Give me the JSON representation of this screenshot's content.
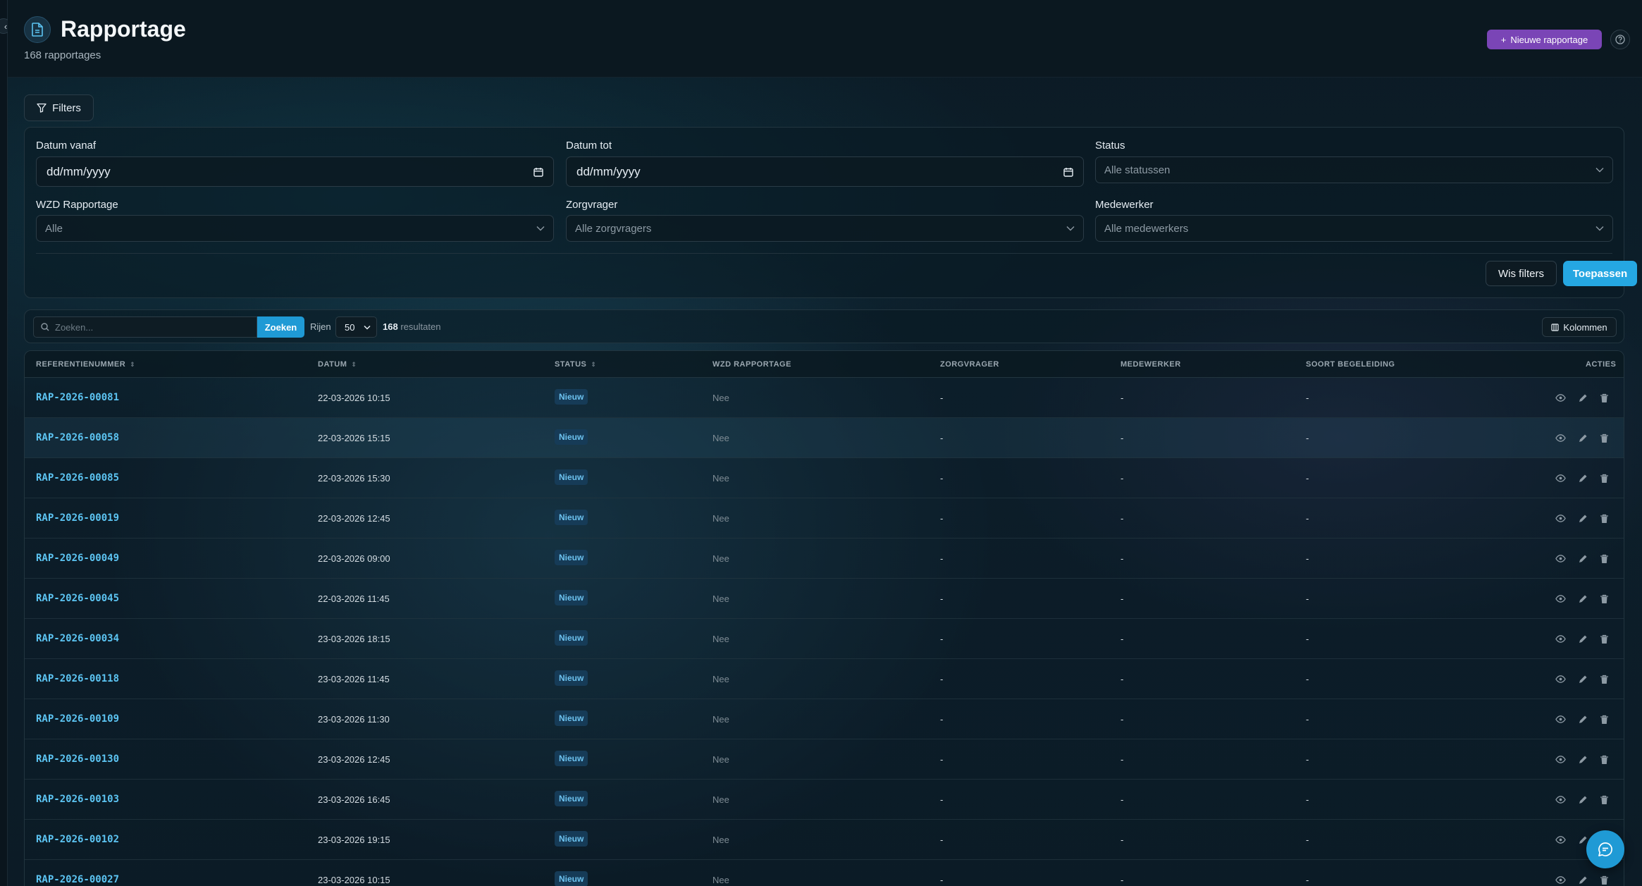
{
  "header": {
    "title": "Rapportage",
    "subtitle": "168 rapportages",
    "new_button": "Nieuwe rapportage",
    "new_icon": "+"
  },
  "filters": {
    "toggle_label": "Filters",
    "date_from_label": "Datum vanaf",
    "date_from_placeholder": "dd/mm/yyyy",
    "date_to_label": "Datum tot",
    "date_to_placeholder": "dd/mm/yyyy",
    "status_label": "Status",
    "status_value": "Alle statussen",
    "wzd_label": "WZD Rapportage",
    "wzd_value": "Alle",
    "client_label": "Zorgvrager",
    "client_value": "Alle zorgvragers",
    "employee_label": "Medewerker",
    "employee_value": "Alle medewerkers",
    "clear_button": "Wis filters",
    "apply_button": "Toepassen"
  },
  "toolbar": {
    "search_placeholder": "Zoeken...",
    "search_button": "Zoeken",
    "rows_label": "Rijen",
    "rows_value": "50",
    "results_count": "168",
    "results_label": "resultaten",
    "columns_button": "Kolommen"
  },
  "table": {
    "headers": {
      "ref": "REFERENTIENUMMER",
      "date": "DATUM",
      "status": "STATUS",
      "wzd": "WZD RAPPORTAGE",
      "client": "ZORGVRAGER",
      "employee": "MEDEWERKER",
      "type": "SOORT BEGELEIDING",
      "actions": "ACTIES"
    },
    "rows": [
      {
        "ref": "RAP-2026-00081",
        "date": "22-03-2026 10:15",
        "status": "Nieuw",
        "wzd": "Nee",
        "client": "-",
        "employee": "-",
        "type": "-"
      },
      {
        "ref": "RAP-2026-00058",
        "date": "22-03-2026 15:15",
        "status": "Nieuw",
        "wzd": "Nee",
        "client": "-",
        "employee": "-",
        "type": "-"
      },
      {
        "ref": "RAP-2026-00085",
        "date": "22-03-2026 15:30",
        "status": "Nieuw",
        "wzd": "Nee",
        "client": "-",
        "employee": "-",
        "type": "-"
      },
      {
        "ref": "RAP-2026-00019",
        "date": "22-03-2026 12:45",
        "status": "Nieuw",
        "wzd": "Nee",
        "client": "-",
        "employee": "-",
        "type": "-"
      },
      {
        "ref": "RAP-2026-00049",
        "date": "22-03-2026 09:00",
        "status": "Nieuw",
        "wzd": "Nee",
        "client": "-",
        "employee": "-",
        "type": "-"
      },
      {
        "ref": "RAP-2026-00045",
        "date": "22-03-2026 11:45",
        "status": "Nieuw",
        "wzd": "Nee",
        "client": "-",
        "employee": "-",
        "type": "-"
      },
      {
        "ref": "RAP-2026-00034",
        "date": "23-03-2026 18:15",
        "status": "Nieuw",
        "wzd": "Nee",
        "client": "-",
        "employee": "-",
        "type": "-"
      },
      {
        "ref": "RAP-2026-00118",
        "date": "23-03-2026 11:45",
        "status": "Nieuw",
        "wzd": "Nee",
        "client": "-",
        "employee": "-",
        "type": "-"
      },
      {
        "ref": "RAP-2026-00109",
        "date": "23-03-2026 11:30",
        "status": "Nieuw",
        "wzd": "Nee",
        "client": "-",
        "employee": "-",
        "type": "-"
      },
      {
        "ref": "RAP-2026-00130",
        "date": "23-03-2026 12:45",
        "status": "Nieuw",
        "wzd": "Nee",
        "client": "-",
        "employee": "-",
        "type": "-"
      },
      {
        "ref": "RAP-2026-00103",
        "date": "23-03-2026 16:45",
        "status": "Nieuw",
        "wzd": "Nee",
        "client": "-",
        "employee": "-",
        "type": "-"
      },
      {
        "ref": "RAP-2026-00102",
        "date": "23-03-2026 19:15",
        "status": "Nieuw",
        "wzd": "Nee",
        "client": "-",
        "employee": "-",
        "type": "-"
      },
      {
        "ref": "RAP-2026-00027",
        "date": "23-03-2026 10:15",
        "status": "Nieuw",
        "wzd": "Nee",
        "client": "-",
        "employee": "-",
        "type": "-"
      }
    ]
  },
  "colors": {
    "accent": "#25a7e2",
    "brand_purple": "#7a45b6",
    "ref_link": "#5cc4f2",
    "badge_bg": "#163b57"
  },
  "icons": [
    "document-icon",
    "plus-icon",
    "help-icon",
    "filter-icon",
    "calendar-icon",
    "chevron-down-icon",
    "search-icon",
    "columns-icon",
    "eye-icon",
    "edit-icon",
    "trash-icon",
    "chat-icon",
    "chevron-left-icon"
  ]
}
